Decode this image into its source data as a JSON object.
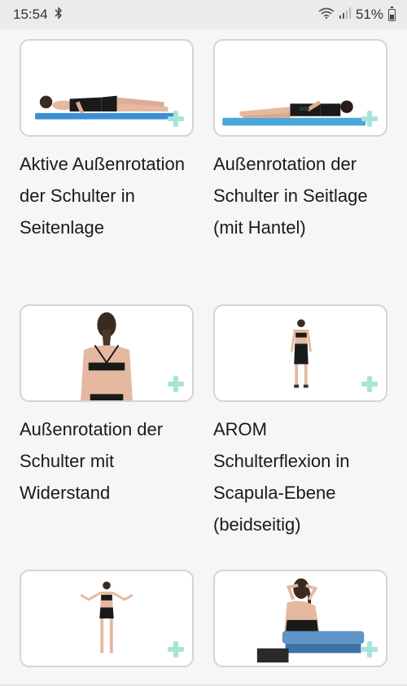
{
  "status_bar": {
    "time": "15:54",
    "bluetooth_icon": "bluetooth-icon",
    "wifi_icon": "wifi-icon",
    "signal_icon": "signal-icon",
    "battery_percent": "51%"
  },
  "exercises": [
    {
      "title": "Aktive Außenrotation der Schulter in Seitenlage",
      "image": "side-lying-woman-on-mat"
    },
    {
      "title": "Außenrotation der Schulter in Seitlage (mit Hantel)",
      "image": "side-lying-woman-with-dumbbell"
    },
    {
      "title": "Außenrotation der Schulter mit Widerstand",
      "image": "woman-back-view"
    },
    {
      "title": "AROM Schulterflexion in Scapula-Ebene (beidseitig)",
      "image": "woman-standing-back-view"
    },
    {
      "title": "",
      "image": "woman-arms-raised-sideways"
    },
    {
      "title": "",
      "image": "woman-with-step-platform"
    }
  ],
  "colors": {
    "background": "#f7f6f5",
    "card_border": "#d4d4d4",
    "plus_accent": "#a8e3d8",
    "mat_blue": "#3a8fd6"
  }
}
